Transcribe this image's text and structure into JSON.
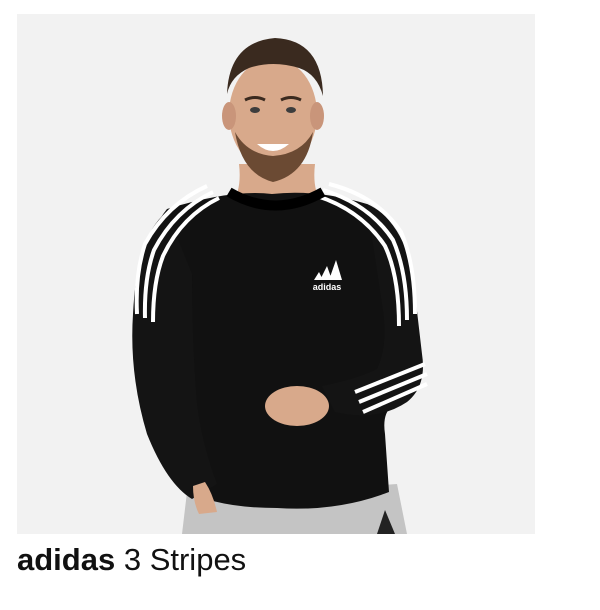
{
  "product": {
    "brand": "adidas",
    "name": "3 Stripes",
    "logo_text": "adidas"
  },
  "colors": {
    "background": "#f2f2f2",
    "sweatshirt": "#111111",
    "stripes": "#ffffff",
    "pants": "#c4c4c4"
  }
}
